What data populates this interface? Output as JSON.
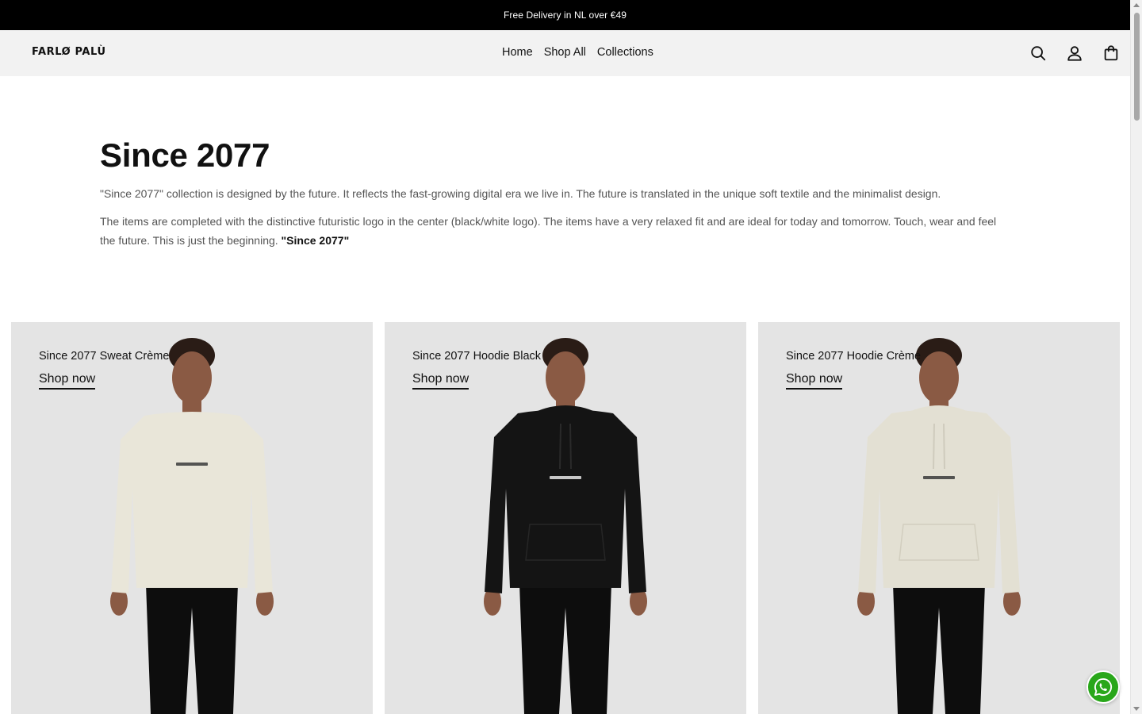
{
  "announcement": {
    "text": "Free Delivery in NL over €49"
  },
  "header": {
    "logo": "FARLØ PALÙ",
    "nav": [
      "Home",
      "Shop All",
      "Collections"
    ],
    "icons": [
      "search-icon",
      "account-icon",
      "cart-bag-icon"
    ]
  },
  "intro": {
    "title": "Since 2077",
    "paragraph1": "\"Since 2077\" collection is designed by the future. It reflects the fast-growing digital era we live in. The future is translated in the unique soft textile and the minimalist design.",
    "paragraph2": "The items are completed with the distinctive futuristic logo in the center (black/white logo). The items have a very relaxed fit and are ideal for today and tomorrow. Touch, wear and feel the future. This is just the beginning.",
    "paragraph2_emphasis": "\"Since 2077\""
  },
  "products": [
    {
      "title": "Since 2077 Sweat Crème",
      "cta": "Shop now",
      "garment": "sweatshirt",
      "garment_color": "#e9e6d9"
    },
    {
      "title": "Since 2077 Hoodie Black",
      "cta": "Shop now",
      "garment": "hoodie",
      "garment_color": "#141414"
    },
    {
      "title": "Since 2077 Hoodie Crème",
      "cta": "Shop now",
      "garment": "hoodie",
      "garment_color": "#e3e0d3"
    }
  ],
  "floating": {
    "whatsapp_icon": "whatsapp-icon",
    "whatsapp_color": "#29a71a"
  }
}
